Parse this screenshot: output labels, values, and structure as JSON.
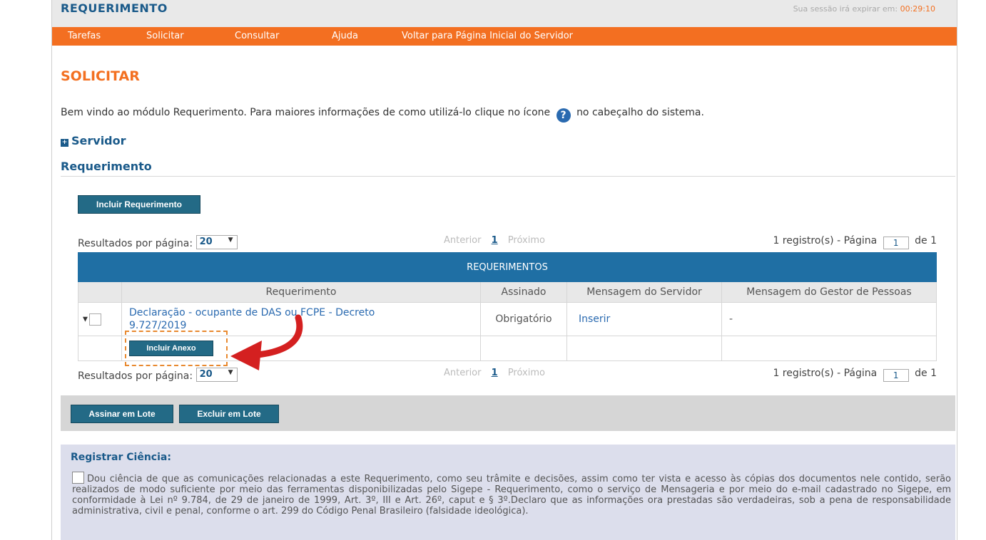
{
  "header": {
    "app_title": "REQUERIMENTO",
    "session_label": "Sua sessão irá expirar em:",
    "session_timer": "00:29:10"
  },
  "menu": {
    "items": [
      "Tarefas",
      "Solicitar",
      "Consultar",
      "Ajuda",
      "Voltar para Página Inicial do Servidor"
    ]
  },
  "page": {
    "title": "SOLICITAR",
    "welcome_before": "Bem vindo ao módulo Requerimento. Para maiores informações de como utilizá-lo clique no ícone",
    "welcome_after": "no cabeçalho do sistema.",
    "help_icon": "?",
    "servidor_label": "Servidor",
    "requerimento_label": "Requerimento"
  },
  "buttons": {
    "incluir_requerimento": "Incluir Requerimento",
    "incluir_anexo": "Incluir Anexo",
    "assinar_lote": "Assinar em Lote",
    "excluir_lote": "Excluir em Lote"
  },
  "pager": {
    "rpp_label": "Resultados por página:",
    "rpp_value": "20",
    "prev": "Anterior",
    "page_num": "1",
    "next": "Próximo",
    "records_label": "1 registro(s) - Página",
    "page_input": "1",
    "of_label": "de 1"
  },
  "table": {
    "caption": "REQUERIMENTOS",
    "columns": [
      "Requerimento",
      "Assinado",
      "Mensagem do Servidor",
      "Mensagem do Gestor de Pessoas"
    ],
    "rows": [
      {
        "requerimento": "Declaração - ocupante de DAS ou FCPE - Decreto 9.727/2019",
        "assinado": "Obrigatório",
        "msg_servidor": "Inserir",
        "msg_gestor": "-"
      }
    ]
  },
  "ciencia": {
    "title": "Registrar Ciência:",
    "text": "Dou ciência de que as comunicações relacionadas a este Requerimento, como seu trâmite e decisões, assim como ter vista e acesso às cópias dos documentos nele contido, serão realizados de modo suficiente por meio das ferramentas disponibilizadas pelo Sigepe - Requerimento, como o serviço de Mensageria e por meio do e-mail cadastrado no Sigepe, em conformidade à Lei nº 9.784, de 29 de janeiro de 1999, Art. 3º, III e Art. 26º, caput e § 3º.Declaro que as informações ora prestadas são verdadeiras, sob a pena de responsabilidade administrativa, civil e penal, conforme o art. 299 do Código Penal Brasileiro (falsidade ideológica)."
  },
  "colors": {
    "accent": "#f37021",
    "primary": "#1f6fa4",
    "annotation_arrow": "#d42020"
  }
}
